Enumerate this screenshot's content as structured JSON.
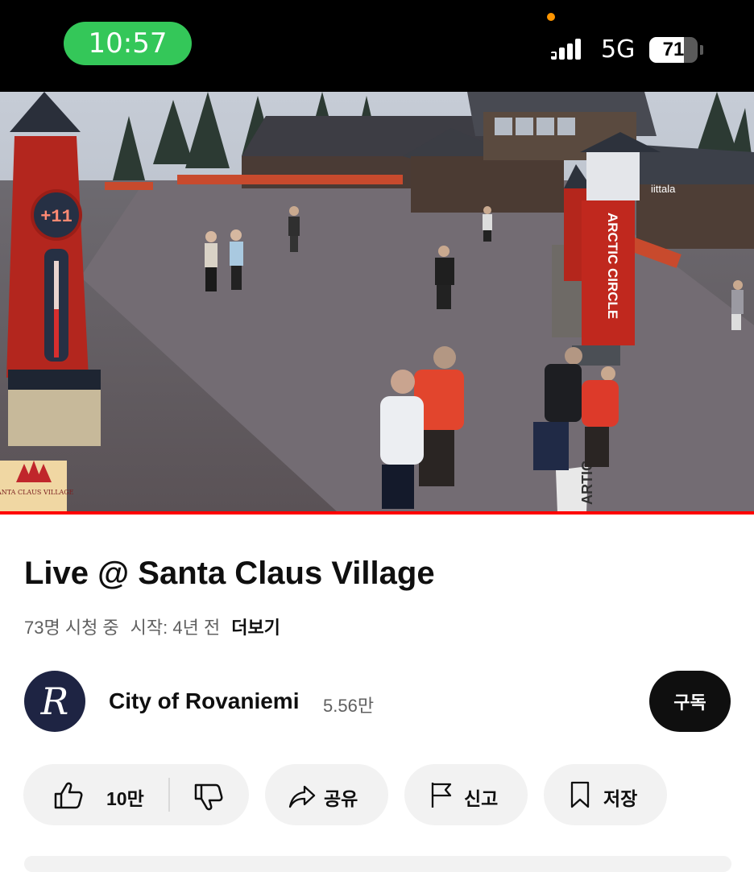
{
  "status_bar": {
    "time": "10:57",
    "network": "5G",
    "battery": "71",
    "battery_level": 0.71,
    "time_pill_color": "#34c759"
  },
  "video": {
    "overlay_logo_text": "SANTA CLAUS VILLAGE",
    "scene_signs": {
      "arctic_circle": "ARCTIC CIRCLE",
      "thermometer": "+11",
      "store": "iittala",
      "ground_sign": "ARTIC"
    },
    "progress_color": "#ff0000"
  },
  "details": {
    "title": "Live @ Santa Claus Village",
    "watching": "73명 시청 중",
    "started": "시작: 4년 전",
    "more": "더보기"
  },
  "channel": {
    "avatar_letter": "R",
    "name": "City of Rovaniemi",
    "subscribers": "5.56만",
    "subscribe_label": "구독"
  },
  "actions": {
    "like_count": "10만",
    "share_label": "공유",
    "report_label": "신고",
    "save_label": "저장",
    "icons": [
      "thumbs-up-icon",
      "thumbs-down-icon",
      "share-icon",
      "flag-icon",
      "bookmark-icon"
    ]
  }
}
